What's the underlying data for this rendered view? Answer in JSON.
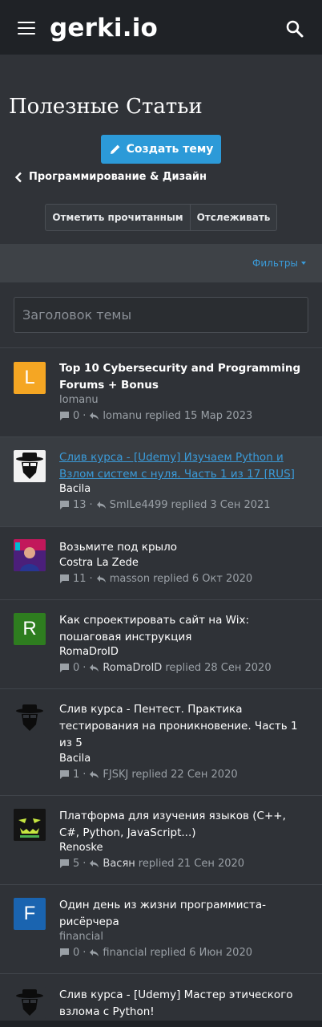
{
  "header": {
    "logo": "gerki.io"
  },
  "page": {
    "title": "Полезные Статьи",
    "create_button": "Создать тему",
    "breadcrumb": "Программирование & Дизайн",
    "mark_read": "Отметить прочитанным",
    "watch": "Отслеживать",
    "filters": "Фильтры",
    "title_placeholder": "Заголовок темы"
  },
  "colors": {
    "accent": "#2c9ad8",
    "link": "#3a9bd9",
    "background": "#2f3237",
    "topbar": "#1f2226"
  },
  "threads": [
    {
      "title": "Top 10 Cybersecurity and Programming Forums + Bonus",
      "author": "lomanu",
      "replies": "0",
      "last_user": "lomanu",
      "replied_word": "replied",
      "date": "15 Мар 2023",
      "avatar_letter": "L",
      "avatar_color": "#f5a623"
    },
    {
      "title": "Слив курса - [Udemy] Изучаем Python и Взлом систем с нуля. Часть 1 из 17 [RUS]",
      "author": "Bacila",
      "replies": "13",
      "last_user": "SmILe4499",
      "replied_word": "replied",
      "date": "3 Сен 2021",
      "avatar_icon": "heisenberg-avatar"
    },
    {
      "title": "Возьмите под крыло",
      "author": "Costra La Zede",
      "replies": "11",
      "last_user": "masson",
      "replied_word": "replied",
      "date": "6 Окт 2020",
      "avatar_icon": "photo-avatar"
    },
    {
      "title": "Как спроектировать сайт на Wix: пошаговая инструкция",
      "author": "RomaDroID",
      "replies": "0",
      "last_user": "RomaDroID",
      "replied_word": "replied",
      "date": "28 Сен 2020",
      "avatar_letter": "R",
      "avatar_color": "#2e7d1f"
    },
    {
      "title": "Слив курса - Пентест. Практика тестирования на проникновение. Часть 1 из 5",
      "author": "Bacila",
      "replies": "1",
      "last_user": "FJSKJ",
      "replied_word": "replied",
      "date": "22 Сен 2020",
      "avatar_icon": "heisenberg-avatar"
    },
    {
      "title": "Платформа для изучения языков (C++, C#, Python, JavaScript...)",
      "author": "Renoske",
      "replies": "5",
      "last_user": "Васян",
      "replied_word": "replied",
      "date": "21 Сен 2020",
      "avatar_icon": "pumpkin-avatar"
    },
    {
      "title": "Один день из жизни программиста-рисёрчера",
      "author": "financial",
      "replies": "0",
      "last_user": "financial",
      "replied_word": "replied",
      "date": "6 Июн 2020",
      "avatar_letter": "F",
      "avatar_color": "#1a64b0"
    },
    {
      "title": "Слив курса - [Udemy] Мастер этического взлома с Python!",
      "author": "",
      "replies": "",
      "last_user": "",
      "replied_word": "",
      "date": "",
      "avatar_icon": "heisenberg-avatar"
    }
  ]
}
